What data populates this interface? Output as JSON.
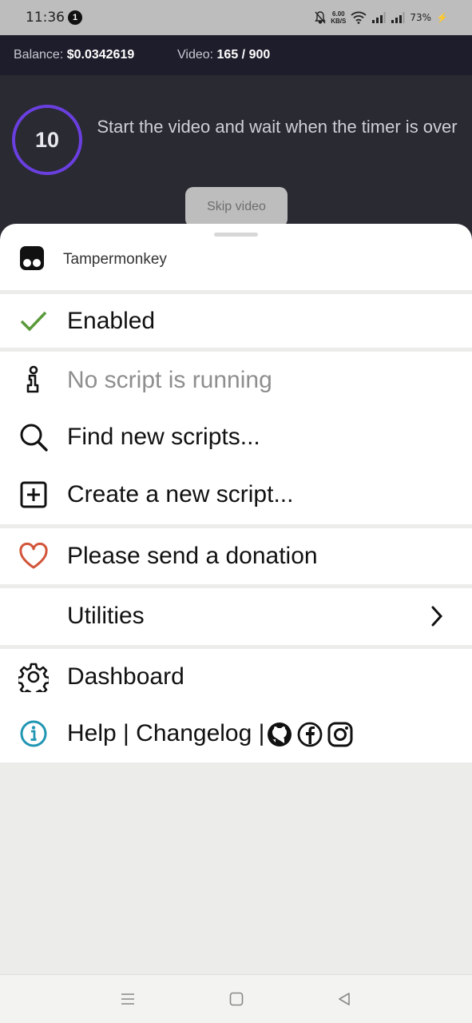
{
  "status_bar": {
    "time": "11:36",
    "notification_count": "1",
    "speed_value": "6.00",
    "speed_unit": "KB/S",
    "battery": "73%"
  },
  "web": {
    "balance_label": "Balance:",
    "balance_value": "$0.0342619",
    "video_label": "Video:",
    "video_value": "165 / 900",
    "timer_value": "10",
    "timer_message": "Start the video and wait when the timer is over",
    "skip_button": "Skip video",
    "timer_color": "#6a3fe0"
  },
  "sheet": {
    "app_name": "Tampermonkey",
    "items": [
      {
        "label": "Enabled",
        "icon": "checkmark-icon",
        "color": "#5a9a3a"
      },
      {
        "label": "No script is running",
        "icon": "info-script-icon"
      },
      {
        "label": "Find new scripts...",
        "icon": "search-icon"
      },
      {
        "label": "Create a new script...",
        "icon": "plus-square-icon"
      },
      {
        "label": "Please send a donation",
        "icon": "heart-icon",
        "color": "#d2553a"
      },
      {
        "label": "Utilities",
        "icon": "chevron-right-icon"
      },
      {
        "label": "Dashboard",
        "icon": "gear-icon"
      },
      {
        "label": "Help | Changelog |",
        "icon": "info-circle-icon",
        "color": "#2196b3"
      }
    ]
  },
  "nav": {
    "buttons": [
      "menu-icon",
      "home-icon",
      "back-icon"
    ]
  }
}
